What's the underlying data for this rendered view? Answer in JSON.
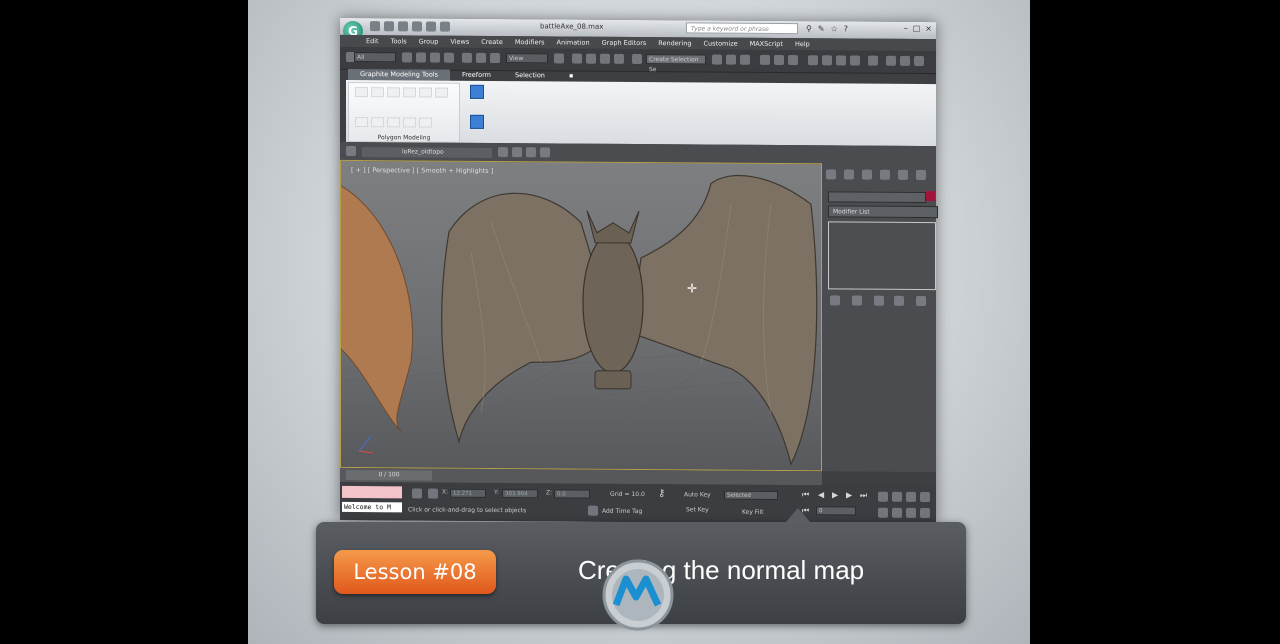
{
  "app": {
    "logo_glyph": "G",
    "title": "battleAxe_08.max",
    "search_placeholder": "Type a keyword or phrase",
    "menu": [
      "Edit",
      "Tools",
      "Group",
      "Views",
      "Create",
      "Modifiers",
      "Animation",
      "Graph Editors",
      "Rendering",
      "Customize",
      "MAXScript",
      "Help"
    ],
    "toolbar": {
      "filter_value": "All",
      "view_value": "View",
      "selection_set_placeholder": "Create Selection Se"
    },
    "ribbon": {
      "tabs": [
        "Graphite Modeling Tools",
        "Freeform",
        "Selection"
      ],
      "active_tab": 0,
      "panel_label": "Polygon Modeling"
    },
    "layer_dropdown": "loRez_oldtopo",
    "viewport_label": "[ + ] [ Perspective ] [ Smooth + Highlights ]",
    "command_panel": {
      "modifier_list": "Modifier List",
      "object_color": "#a3143b"
    },
    "timeline": {
      "frame": "0 / 100"
    },
    "status": {
      "maxscript_output": "Welcome to M",
      "x_value": "12.271",
      "y_value": "303.904",
      "z_value": "0.0",
      "grid": "Grid = 10.0",
      "hint": "Click or click-and-drag to select objects",
      "add_time_tag": "Add Time Tag",
      "auto_key": "Auto Key",
      "set_key": "Set Key",
      "key_mode": "Selected",
      "key_filters": "Key Filt",
      "frame_field": "0",
      "labels": {
        "x": "X:",
        "y": "Y:",
        "z": "Z:"
      }
    }
  },
  "overlay": {
    "lesson_badge": "Lesson #08",
    "lesson_title": "Creating the normal map"
  },
  "colors": {
    "accent_orange": "#e8702a",
    "panel_bg": "#4a4c4f",
    "selection_blue": "#3d7fd4"
  }
}
